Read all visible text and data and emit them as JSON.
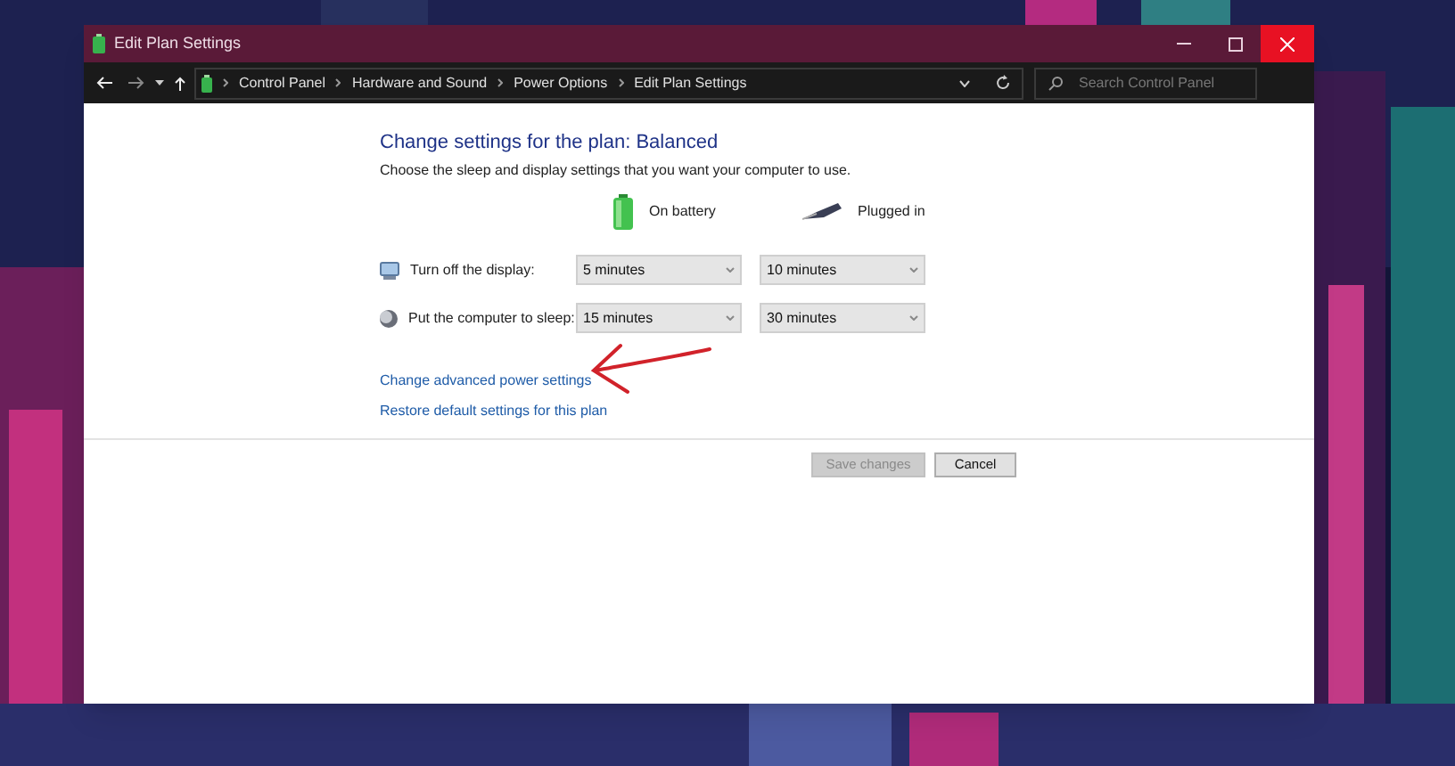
{
  "window": {
    "title": "Edit Plan Settings"
  },
  "address_bar": {
    "breadcrumbs": [
      "Control Panel",
      "Hardware and Sound",
      "Power Options",
      "Edit Plan Settings"
    ]
  },
  "search": {
    "placeholder": "Search Control Panel"
  },
  "heading": "Change settings for the plan: Balanced",
  "description": "Choose the sleep and display settings that you want your computer to use.",
  "columns": [
    {
      "kind": "battery",
      "label": "On battery"
    },
    {
      "kind": "plug",
      "label": "Plugged in"
    }
  ],
  "settings": [
    {
      "kind": "display",
      "label": "Turn off the display:",
      "values": [
        "5 minutes",
        "10 minutes"
      ]
    },
    {
      "kind": "sleep",
      "label": "Put the computer to sleep:",
      "values": [
        "15 minutes",
        "30 minutes"
      ]
    }
  ],
  "links": [
    "Change advanced power settings",
    "Restore default settings for this plan"
  ],
  "buttons": [
    {
      "label": "Save changes",
      "disabled": true
    },
    {
      "label": "Cancel",
      "disabled": false
    }
  ]
}
